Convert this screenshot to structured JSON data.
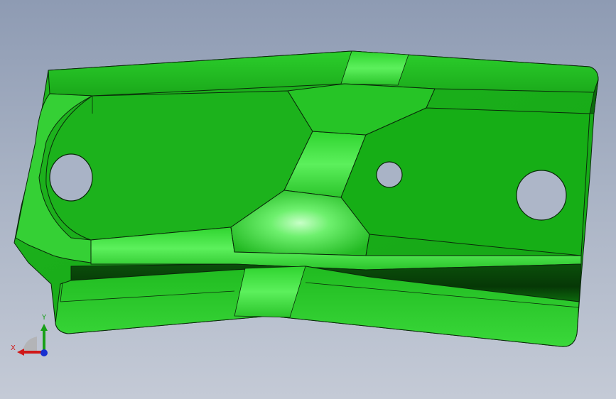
{
  "viewport": {
    "background_top": "#8e9bb3",
    "background_bottom": "#c4cad6"
  },
  "model": {
    "part_color": "#22b922",
    "highlight_color": "#5cf05c",
    "shadow_color": "#0b5a0b",
    "edge_color": "#0a2a0a",
    "holes": 3
  },
  "triad": {
    "x_label": "X",
    "y_label": "Y",
    "x_color": "#d01818",
    "y_color": "#18a018",
    "z_color": "#1830d0"
  }
}
